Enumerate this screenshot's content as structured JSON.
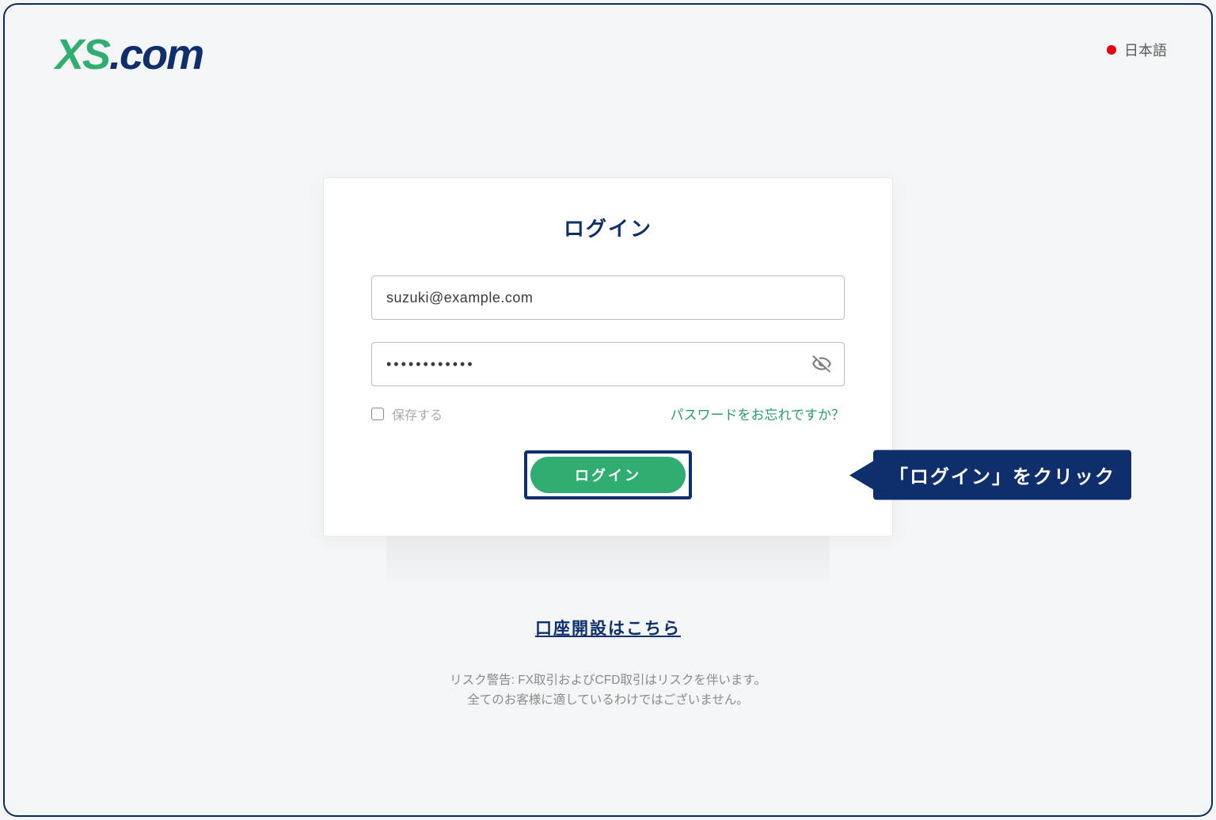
{
  "header": {
    "logo": {
      "part1": "XS",
      "part2": ".com"
    },
    "language": "日本語"
  },
  "login": {
    "title": "ログイン",
    "email_value": "suzuki@example.com",
    "password_value": "••••••••••••",
    "remember_label": "保存する",
    "forgot_label": "パスワードをお忘れですか？",
    "submit_label": "ログイン"
  },
  "callout": {
    "text": "「ログイン」をクリック"
  },
  "signup": {
    "link": "口座開設はこちら"
  },
  "risk": {
    "line1": "リスク警告: FX取引およびCFD取引はリスクを伴います。",
    "line2": "全てのお客様に適しているわけではございません。"
  },
  "colors": {
    "brand_green": "#30ad70",
    "brand_navy": "#0e2f6c",
    "accent_link": "#2a9d6a"
  }
}
